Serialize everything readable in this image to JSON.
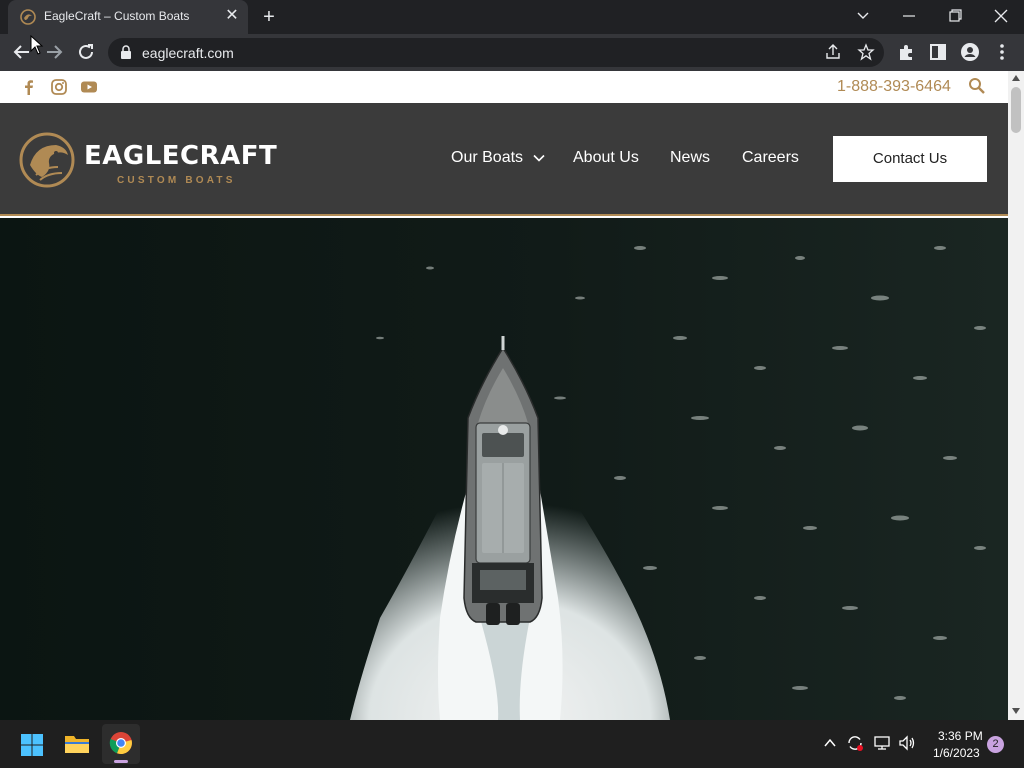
{
  "browser": {
    "tab_title": "EagleCraft – Custom Boats",
    "url": "eaglecraft.com",
    "icons": [
      "back-icon",
      "forward-icon",
      "reload-icon",
      "lock-icon",
      "share-icon",
      "star-icon",
      "extensions-icon",
      "side-panel-icon",
      "profile-icon",
      "menu-icon"
    ]
  },
  "site": {
    "phone": "1-888-393-6464",
    "logo_word": "EAGLECRAFT",
    "logo_sub": "CUSTOM BOATS",
    "nav": {
      "our_boats": "Our Boats",
      "about": "About Us",
      "news": "News",
      "careers": "Careers",
      "contact": "Contact Us"
    },
    "colors": {
      "gold": "#b08a54",
      "header_bg": "#3b3b3b"
    }
  },
  "taskbar": {
    "time": "3:36 PM",
    "date": "1/6/2023",
    "notifications": "2"
  }
}
